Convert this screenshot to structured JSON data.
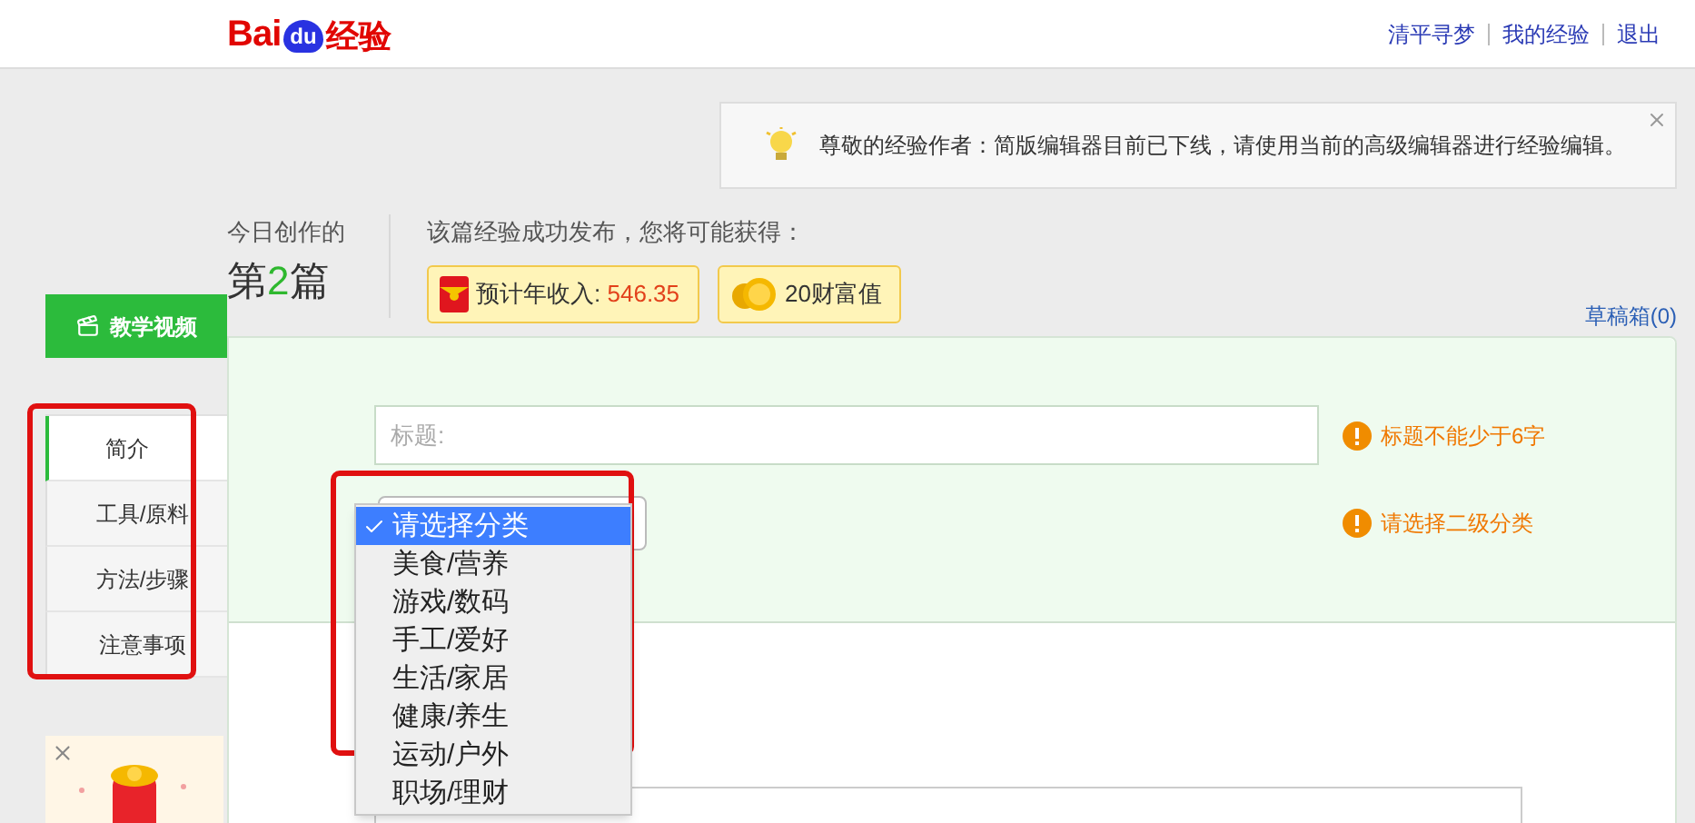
{
  "header": {
    "logo": {
      "left": "Bai",
      "paw": "du",
      "right": "经验"
    },
    "links": [
      "清平寻梦",
      "我的经验",
      "退出"
    ]
  },
  "notice": {
    "text": "尊敬的经验作者：简版编辑器目前已下线，请使用当前的高级编辑器进行经验编辑。"
  },
  "stats": {
    "today_label": "今日创作的",
    "count_prefix": "第",
    "count": "2",
    "count_suffix": "篇",
    "reward_label": "该篇经验成功发布，您将可能获得：",
    "badges": [
      {
        "kind": "income",
        "label": "预计年收入:",
        "value": "546.35"
      },
      {
        "kind": "wealth",
        "label": "20财富值"
      }
    ]
  },
  "sidebar": {
    "video_button": "教学视频",
    "nav": [
      {
        "label": "简介",
        "selected": true
      },
      {
        "label": "工具/原料",
        "selected": false
      },
      {
        "label": "方法/步骤",
        "selected": false
      },
      {
        "label": "注意事项",
        "selected": false
      }
    ]
  },
  "drafts_link": "草稿箱(0)",
  "form": {
    "title_field": {
      "placeholder": "标题:"
    },
    "title_warning": "标题不能少于6字",
    "category_warning": "请选择二级分类",
    "category_options": [
      {
        "label": "请选择分类",
        "selected": true
      },
      {
        "label": "美食/营养",
        "selected": false
      },
      {
        "label": "游戏/数码",
        "selected": false
      },
      {
        "label": "手工/爱好",
        "selected": false
      },
      {
        "label": "生活/家居",
        "selected": false
      },
      {
        "label": "健康/养生",
        "selected": false
      },
      {
        "label": "运动/户外",
        "selected": false
      },
      {
        "label": "职场/理财",
        "selected": false
      }
    ]
  }
}
